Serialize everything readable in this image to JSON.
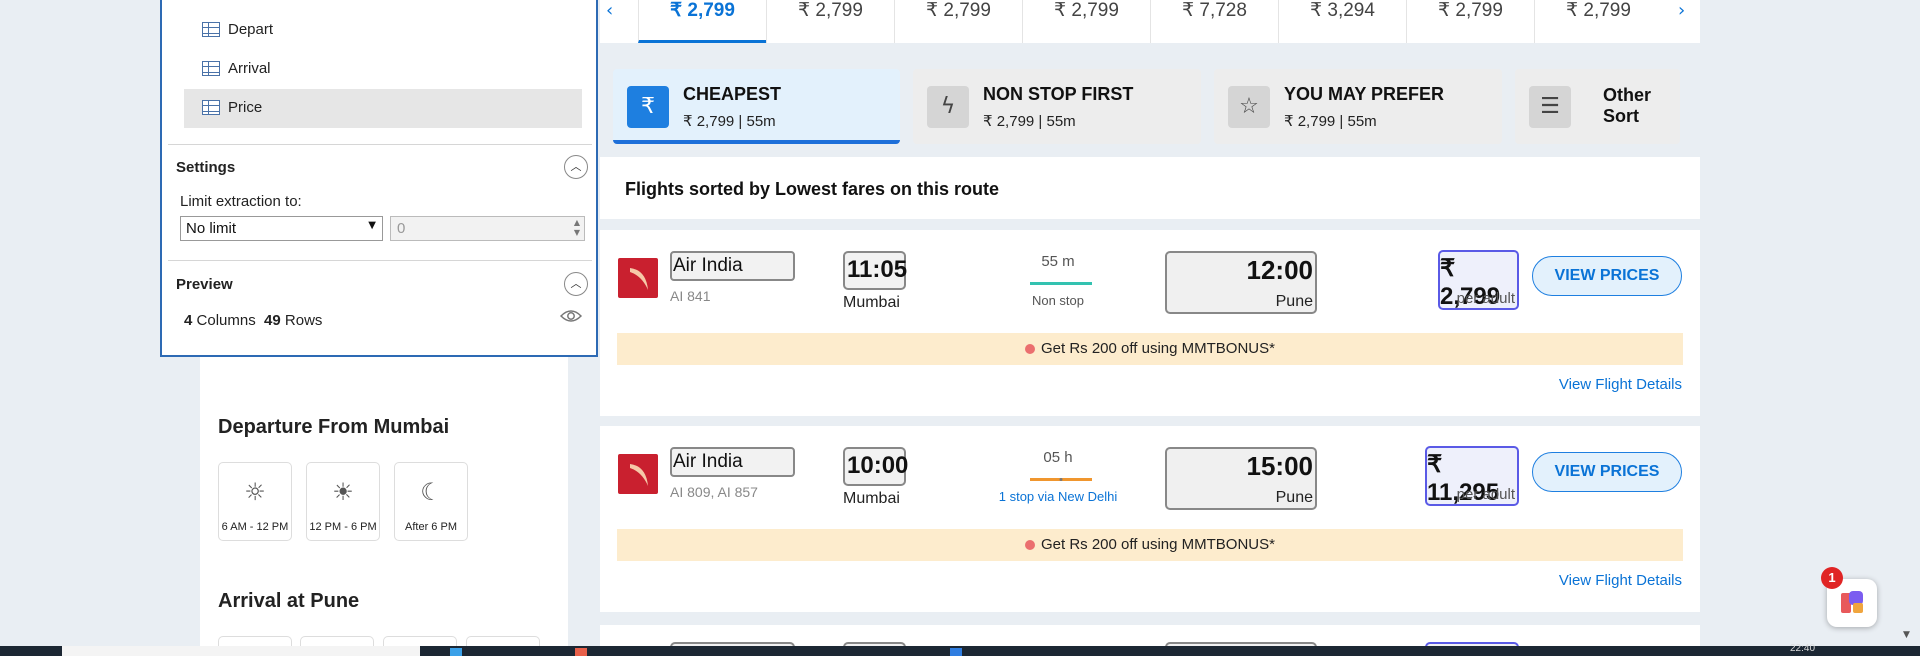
{
  "filters": {
    "departure_title": "Departure From Mumbai",
    "departure_slots": [
      {
        "label": "6 AM - 12 PM",
        "icon": "sun-icon"
      },
      {
        "label": "12 PM - 6 PM",
        "icon": "sunset-icon"
      },
      {
        "label": "After 6 PM",
        "icon": "moon-icon"
      }
    ],
    "arrival_title": "Arrival at Pune"
  },
  "extraction_panel": {
    "columns": [
      {
        "label": "Depart",
        "selected": false
      },
      {
        "label": "Arrival",
        "selected": false
      },
      {
        "label": "Price",
        "selected": true
      }
    ],
    "settings_title": "Settings",
    "limit_label": "Limit extraction to:",
    "limit_value": "No limit",
    "limit_number": "0",
    "preview_title": "Preview",
    "columns_count": "4",
    "columns_word": "Columns",
    "rows_count": "49",
    "rows_word": "Rows"
  },
  "date_bar": {
    "prices": [
      "₹ 2,799",
      "₹ 2,799",
      "₹ 2,799",
      "₹ 2,799",
      "₹ 7,728",
      "₹ 3,294",
      "₹ 2,799",
      "₹ 2,799"
    ],
    "active_index": 0
  },
  "sort_tabs": [
    {
      "title": "CHEAPEST",
      "sub": "₹ 2,799 | 55m",
      "icon": "rupee-icon",
      "active": true
    },
    {
      "title": "NON STOP FIRST",
      "sub": "₹ 2,799 | 55m",
      "icon": "lightning-icon",
      "active": false
    },
    {
      "title": "YOU MAY PREFER",
      "sub": "₹ 2,799 | 55m",
      "icon": "star-icon",
      "active": false
    },
    {
      "title": "Other Sort",
      "icon": "sort-icon",
      "active": false
    }
  ],
  "sorted_heading": "Flights sorted by Lowest fares on this route",
  "flights": [
    {
      "airline": "Air India",
      "flight_no": "AI 841",
      "depart_time": "11:05",
      "depart_city": "Mumbai",
      "duration": "55 m",
      "stops": "Non stop",
      "arrive_time": "12:00",
      "arrive_city": "Pune",
      "price": "₹ 2,799",
      "per_adult": "per adult",
      "view_prices": "VIEW PRICES",
      "offer": "Get Rs 200 off using MMTBONUS*",
      "details": "View Flight Details"
    },
    {
      "airline": "Air India",
      "flight_no": "AI 809, AI 857",
      "depart_time": "10:00",
      "depart_city": "Mumbai",
      "duration": "05 h",
      "stops": "1 stop via New Delhi",
      "arrive_time": "15:00",
      "arrive_city": "Pune",
      "price": "₹ 11,295",
      "per_adult": "per adult",
      "view_prices": "VIEW PRICES",
      "offer": "Get Rs 200 off using MMTBONUS*",
      "details": "View Flight Details"
    }
  ],
  "fab_badge": "1",
  "taskbar_time": "22:40",
  "colors": {
    "accent": "#0a73d6",
    "nonstop_line": "#33c2b0",
    "stop_line": "#f0962e",
    "offer_bg": "#fdeccd",
    "airline_red": "#c9202f"
  }
}
